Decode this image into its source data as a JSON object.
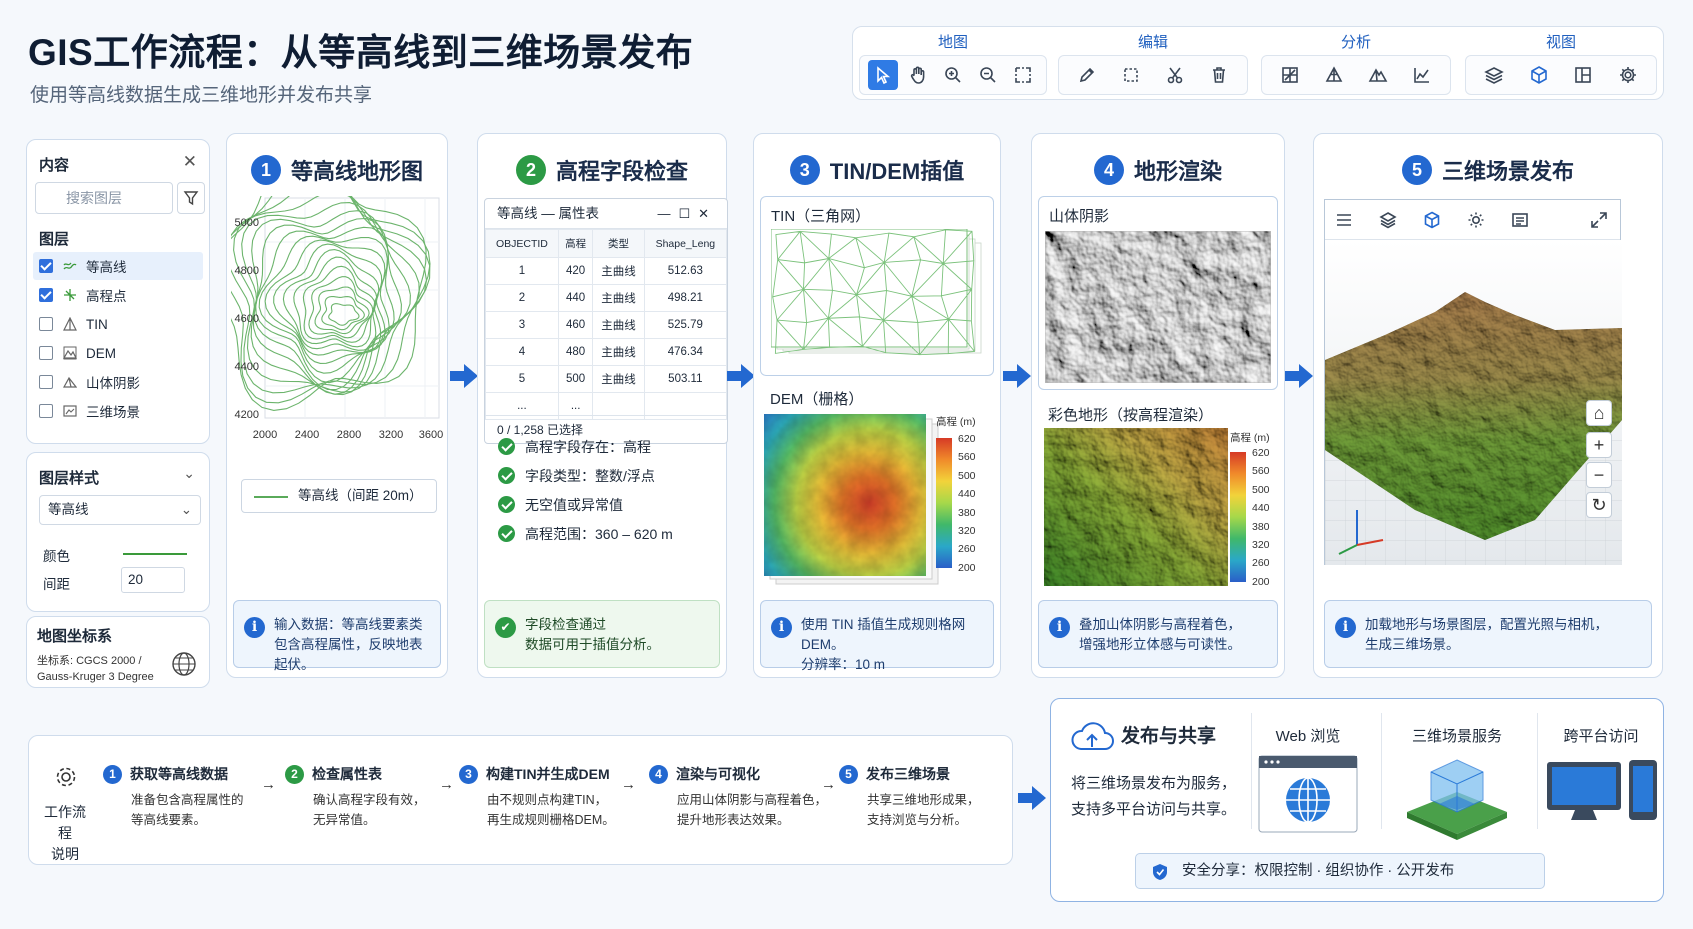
{
  "header": {
    "title": "GIS工作流程：从等高线到三维场景发布",
    "subtitle": "使用等高线数据生成三维地形并发布共享"
  },
  "toolbar": {
    "groups": [
      {
        "label": "地图",
        "icons": [
          "pointer-icon",
          "pan-hand-icon",
          "zoom-in-icon",
          "zoom-out-icon",
          "select-rectangle-icon"
        ]
      },
      {
        "label": "编辑",
        "icons": [
          "pencil-icon",
          "dashed-select-icon",
          "cut-icon",
          "trash-icon"
        ]
      },
      {
        "label": "分析",
        "icons": [
          "raster-grid-icon",
          "tin-triangle-icon",
          "terrain-icon",
          "profile-chart-icon"
        ]
      },
      {
        "label": "视图",
        "icons": [
          "layers-icon",
          "3d-cube-icon",
          "split-view-icon",
          "settings-gear-icon"
        ]
      }
    ]
  },
  "contents_panel": {
    "title": "内容",
    "search_placeholder": "搜索图层",
    "layers_heading": "图层",
    "layers": [
      {
        "name": "等高线",
        "checked": true,
        "selected": true,
        "icon": "contour-icon"
      },
      {
        "name": "高程点",
        "checked": true,
        "selected": false,
        "icon": "elevation-point-icon"
      },
      {
        "name": "TIN",
        "checked": false,
        "selected": false,
        "icon": "tin-icon"
      },
      {
        "name": "DEM",
        "checked": false,
        "selected": false,
        "icon": "dem-icon"
      },
      {
        "name": "山体阴影",
        "checked": false,
        "selected": false,
        "icon": "hillshade-icon"
      },
      {
        "name": "三维场景",
        "checked": false,
        "selected": false,
        "icon": "scene-icon"
      }
    ]
  },
  "style_panel": {
    "title": "图层样式",
    "layer_select": "等高线",
    "color_label": "颜色",
    "line_color": "#3a9a3a",
    "interval_label": "间距",
    "interval_value": "20"
  },
  "crs_panel": {
    "title": "地图坐标系",
    "line1": "坐标系: CGCS 2000 /",
    "line2": "Gauss-Kruger 3 Degree"
  },
  "stages": [
    {
      "num": "1",
      "title": "等高线地形图"
    },
    {
      "num": "2",
      "title": "高程字段检查"
    },
    {
      "num": "3",
      "title": "TIN/DEM插值"
    },
    {
      "num": "4",
      "title": "地形渲染"
    },
    {
      "num": "5",
      "title": "三维场景发布"
    }
  ],
  "stage1": {
    "y_ticks": [
      "5000",
      "4800",
      "4600",
      "4400",
      "4200"
    ],
    "x_ticks": [
      "2000",
      "2400",
      "2800",
      "3200",
      "3600"
    ],
    "legend": "等高线（间距 20m）",
    "info_line1": "输入数据：等高线要素类",
    "info_line2": "包含高程属性，反映地表起伏。"
  },
  "stage2": {
    "window_title": "等高线 — 属性表",
    "columns": [
      "OBJECTID",
      "高程",
      "类型",
      "Shape_Leng"
    ],
    "rows": [
      [
        "1",
        "420",
        "主曲线",
        "512.63"
      ],
      [
        "2",
        "440",
        "主曲线",
        "498.21"
      ],
      [
        "3",
        "460",
        "主曲线",
        "525.79"
      ],
      [
        "4",
        "480",
        "主曲线",
        "476.34"
      ],
      [
        "5",
        "500",
        "主曲线",
        "503.11"
      ],
      [
        "...",
        "...",
        "",
        ""
      ]
    ],
    "footer": "0 / 1,258 已选择",
    "checks": [
      "高程字段存在：高程",
      "字段类型：整数/浮点",
      "无空值或异常值",
      "高程范围：360 – 620 m"
    ],
    "info_line1": "字段检查通过",
    "info_line2": "数据可用于插值分析。"
  },
  "stage3": {
    "tin_title": "TIN（三角网）",
    "dem_title": "DEM（栅格）",
    "legend_title": "高程 (m)",
    "legend_ticks": [
      "620",
      "560",
      "500",
      "440",
      "380",
      "320",
      "260",
      "200"
    ],
    "info_line1": "使用 TIN 插值生成规则格网 DEM。",
    "info_line2": "分辨率：10 m"
  },
  "stage4": {
    "hillshade_title": "山体阴影",
    "color_title": "彩色地形（按高程渲染）",
    "legend_title": "高程 (m)",
    "legend_ticks": [
      "620",
      "560",
      "500",
      "440",
      "380",
      "320",
      "260",
      "200"
    ],
    "info_line1": "叠加山体阴影与高程着色，",
    "info_line2": "增强地形立体感与可读性。"
  },
  "stage5": {
    "viewer_icons": [
      "menu-icon",
      "layers-icon",
      "3d-cube-icon",
      "light-sun-icon",
      "list-icon",
      "fullscreen-icon"
    ],
    "side_buttons": [
      "home-icon",
      "zoom-in-plus-icon",
      "zoom-out-minus-icon",
      "rotate-icon"
    ],
    "info_line1": "加载地形与场景图层，配置光照与相机，",
    "info_line2": "生成三维场景。"
  },
  "workflow": {
    "label_line1": "工作流程",
    "label_line2": "说明",
    "steps": [
      {
        "num": "1",
        "title": "获取等高线数据",
        "line1": "准备包含高程属性的",
        "line2": "等高线要素。"
      },
      {
        "num": "2",
        "title": "检查属性表",
        "line1": "确认高程字段有效，",
        "line2": "无异常值。"
      },
      {
        "num": "3",
        "title": "构建TIN并生成DEM",
        "line1": "由不规则点构建TIN，",
        "line2": "再生成规则栅格DEM。"
      },
      {
        "num": "4",
        "title": "渲染与可视化",
        "line1": "应用山体阴影与高程着色，",
        "line2": "提升地形表达效果。"
      },
      {
        "num": "5",
        "title": "发布三维场景",
        "line1": "共享三维地形成果，",
        "line2": "支持浏览与分析。"
      }
    ],
    "arrow_glyph": "→"
  },
  "publish": {
    "title": "发布与共享",
    "desc_line1": "将三维场景发布为服务，",
    "desc_line2": "支持多平台访问与共享。",
    "col1": "Web 浏览",
    "col2": "三维场景服务",
    "col3": "跨平台访问",
    "share": "安全分享：权限控制 · 组织协作 · 公开发布"
  },
  "colors": {
    "accent_blue": "#2368d0",
    "accent_green": "#2c9a45",
    "contour_green": "#5aaa5a"
  }
}
